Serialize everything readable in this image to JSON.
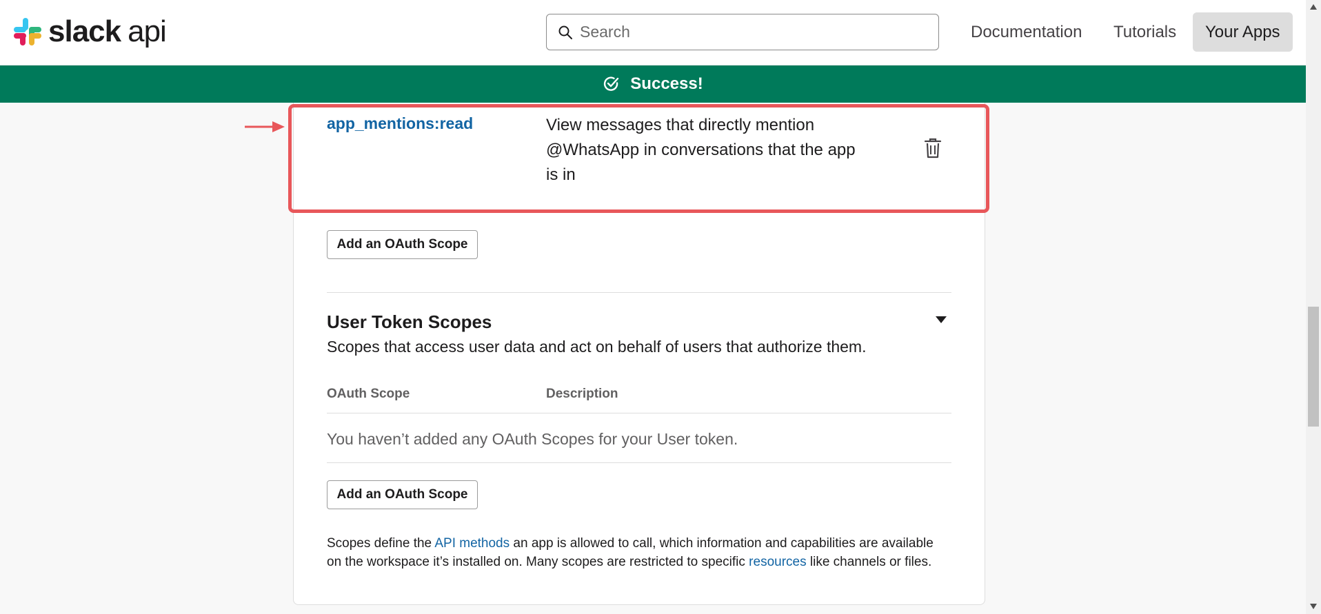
{
  "header": {
    "logo_text": "slack",
    "logo_suffix": "api",
    "search_placeholder": "Search",
    "nav": [
      "Documentation",
      "Tutorials",
      "Your Apps"
    ]
  },
  "banner": {
    "text": "Success!"
  },
  "bot_scope": {
    "name": "app_mentions:read",
    "description": "View messages that directly mention @WhatsApp in conversations that the app is in"
  },
  "buttons": {
    "add_scope": "Add an OAuth Scope"
  },
  "user_token": {
    "title": "User Token Scopes",
    "subtitle": "Scopes that access user data and act on behalf of users that authorize them.",
    "col_scope": "OAuth Scope",
    "col_desc": "Description",
    "empty": "You haven’t added any OAuth Scopes for your User token."
  },
  "footer": {
    "p1": "Scopes define the ",
    "link1": "API methods",
    "p2": " an app is allowed to call, which information and capabilities are available on the workspace it’s installed on. Many scopes are restricted to specific ",
    "link2": "resources",
    "p3": " like channels or files."
  },
  "colors": {
    "success_green": "#007a5a",
    "link_blue": "#1264a3",
    "highlight_red": "#e8575a"
  },
  "icons": [
    "slack-logo-icon",
    "search-icon",
    "check-circle-icon",
    "arrow-icon",
    "trash-icon",
    "caret-down-icon"
  ]
}
